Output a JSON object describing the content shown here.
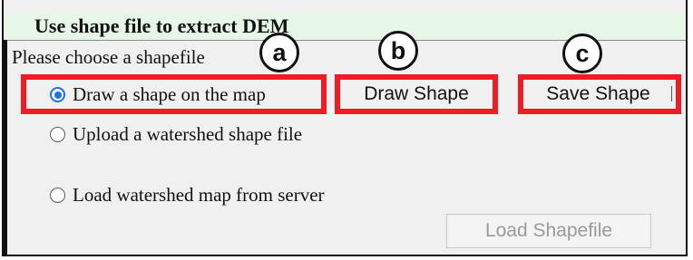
{
  "panel": {
    "title": "Use shape file to extract DEM",
    "prompt": "Please choose a shapefile"
  },
  "options": [
    {
      "label": "Draw a shape on the map",
      "selected": true
    },
    {
      "label": "Upload a watershed shape file",
      "selected": false
    },
    {
      "label": "Load watershed map from server",
      "selected": false
    }
  ],
  "buttons": {
    "draw_shape": "Draw Shape",
    "save_shape": "Save Shape",
    "load_shapefile": "Load Shapefile"
  },
  "annotations": {
    "a": "a",
    "b": "b",
    "c": "c",
    "highlight_color": "#ee1c25"
  },
  "colors": {
    "header_background": "#e6f7e8",
    "panel_background": "#f0f0f0",
    "radio_accent": "#1a73e8"
  }
}
